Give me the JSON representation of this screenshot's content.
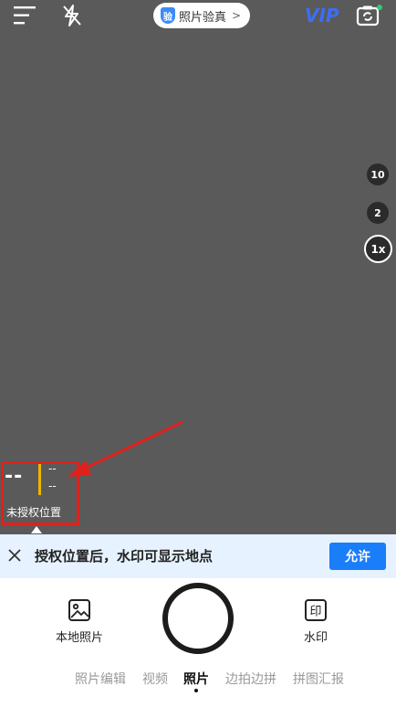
{
  "top_bar": {
    "verify_badge_glyph": "验",
    "verify_label": "照片验真",
    "verify_arrow": ">",
    "vip_label": "VIP",
    "notification_color": "#2ecc71"
  },
  "zoom": {
    "options": [
      "10",
      "2",
      "1x"
    ],
    "selected": "1x"
  },
  "watermark_preview": {
    "time_placeholder": "--",
    "date_line_1": "--",
    "date_line_2": "--",
    "location_label": "未授权位置",
    "accent_color": "#f0b400",
    "highlight_color": "#e0201b"
  },
  "permission_banner": {
    "message": "授权位置后，水印可显示地点",
    "allow_label": "允许"
  },
  "bottom_tools": {
    "local_photos_label": "本地照片",
    "watermark_label": "水印"
  },
  "modes": {
    "items": [
      "照片编辑",
      "视频",
      "照片",
      "边拍边拼",
      "拼图汇报"
    ],
    "active": "照片"
  },
  "colors": {
    "accent": "#1a7dfa",
    "vip": "#3d6ef5",
    "viewfinder": "#5a5a5a"
  }
}
